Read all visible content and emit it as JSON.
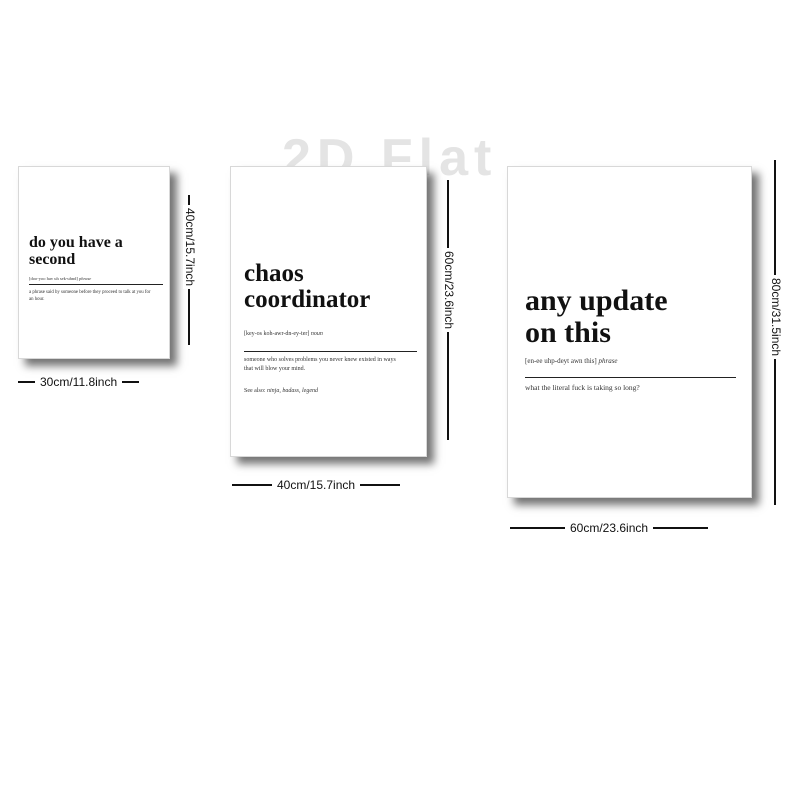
{
  "watermark": "2D Flat",
  "posters": [
    {
      "title_line1": "do you have a",
      "title_line2": "second",
      "pronunciation": "[doo-yoo hav uh sek-uhnd]",
      "part_of_speech": "phrase",
      "definition": "a phrase said by someone before they proceed to talk at you for an hour.",
      "width_label": "30cm/11.8inch",
      "height_label": "40cm/15.7inch"
    },
    {
      "title_line1": "chaos",
      "title_line2": "coordinator",
      "pronunciation": "[key-os koh-awr-dn-ey-ter]",
      "part_of_speech": "noun",
      "definition": "someone who solves problems you never knew existed in ways that will blow your mind.",
      "see_also_label": "See also:",
      "see_also_words": "ninja, badass, legend",
      "width_label": "40cm/15.7inch",
      "height_label": "60cm/23.6inch"
    },
    {
      "title_line1": "any update",
      "title_line2": "on this",
      "pronunciation": "[en-ee uhp-deyt awn this]",
      "part_of_speech": "phrase",
      "definition": "what the literal fuck is taking so long?",
      "width_label": "60cm/23.6inch",
      "height_label": "80cm/31.5inch"
    }
  ]
}
